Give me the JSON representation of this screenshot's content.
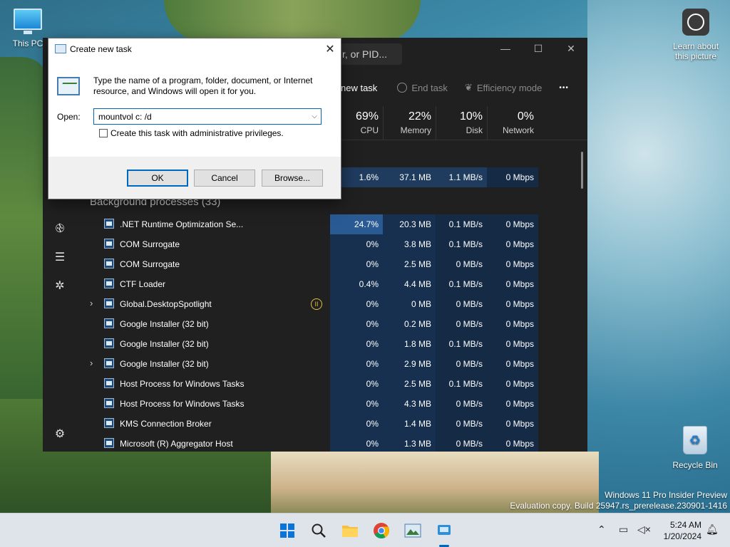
{
  "desktop": {
    "this_pc_label": "This PC",
    "learn_label": "Learn about this picture",
    "recycle_label": "Recycle Bin",
    "watermark_line1": "Windows 11 Pro Insider Preview",
    "watermark_line2": "Evaluation copy. Build 25947.rs_prerelease.230901-1416"
  },
  "task_manager": {
    "search_text": "r, or PID...",
    "toolbar": {
      "run_new_task": "new task",
      "end_task": "End task",
      "efficiency_mode": "Efficiency mode",
      "more": "•••"
    },
    "columns": [
      {
        "pct": "69%",
        "label": "CPU"
      },
      {
        "pct": "22%",
        "label": "Memory"
      },
      {
        "pct": "10%",
        "label": "Disk"
      },
      {
        "pct": "0%",
        "label": "Network"
      }
    ],
    "top_row": {
      "cpu": "1.6%",
      "mem": "37.1 MB",
      "disk": "1.1 MB/s",
      "net": "0 Mbps"
    },
    "group_title": "Background processes (33)",
    "rows": [
      {
        "name": ".NET Runtime Optimization Se...",
        "cpu": "24.7%",
        "mem": "20.3 MB",
        "disk": "0.1 MB/s",
        "net": "0 Mbps"
      },
      {
        "name": "COM Surrogate",
        "cpu": "0%",
        "mem": "3.8 MB",
        "disk": "0.1 MB/s",
        "net": "0 Mbps"
      },
      {
        "name": "COM Surrogate",
        "cpu": "0%",
        "mem": "2.5 MB",
        "disk": "0 MB/s",
        "net": "0 Mbps"
      },
      {
        "name": "CTF Loader",
        "cpu": "0.4%",
        "mem": "4.4 MB",
        "disk": "0.1 MB/s",
        "net": "0 Mbps"
      },
      {
        "name": "Global.DesktopSpotlight",
        "cpu": "0%",
        "mem": "0 MB",
        "disk": "0 MB/s",
        "net": "0 Mbps"
      },
      {
        "name": "Google Installer (32 bit)",
        "cpu": "0%",
        "mem": "0.2 MB",
        "disk": "0 MB/s",
        "net": "0 Mbps"
      },
      {
        "name": "Google Installer (32 bit)",
        "cpu": "0%",
        "mem": "1.8 MB",
        "disk": "0.1 MB/s",
        "net": "0 Mbps"
      },
      {
        "name": "Google Installer (32 bit)",
        "cpu": "0%",
        "mem": "2.9 MB",
        "disk": "0 MB/s",
        "net": "0 Mbps"
      },
      {
        "name": "Host Process for Windows Tasks",
        "cpu": "0%",
        "mem": "2.5 MB",
        "disk": "0.1 MB/s",
        "net": "0 Mbps"
      },
      {
        "name": "Host Process for Windows Tasks",
        "cpu": "0%",
        "mem": "4.3 MB",
        "disk": "0 MB/s",
        "net": "0 Mbps"
      },
      {
        "name": "KMS Connection Broker",
        "cpu": "0%",
        "mem": "1.4 MB",
        "disk": "0 MB/s",
        "net": "0 Mbps"
      },
      {
        "name": "Microsoft (R) Aggregator Host",
        "cpu": "0%",
        "mem": "1.3 MB",
        "disk": "0 MB/s",
        "net": "0 Mbps"
      }
    ]
  },
  "dialog": {
    "title": "Create new task",
    "description": "Type the name of a program, folder, document, or Internet resource, and Windows will open it for you.",
    "open_label": "Open:",
    "open_value": "mountvol c: /d",
    "admin_label": "Create this task with administrative privileges.",
    "ok": "OK",
    "cancel": "Cancel",
    "browse": "Browse..."
  },
  "taskbar": {
    "time": "5:24 AM",
    "date": "1/20/2024"
  }
}
